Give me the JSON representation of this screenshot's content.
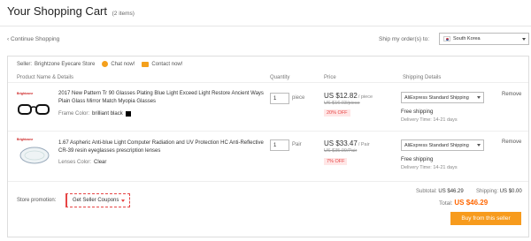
{
  "header": {
    "title": "Your Shopping Cart",
    "item_count": "(2 items)"
  },
  "nav": {
    "continue_label": "Continue Shopping",
    "ship_label": "Ship my order(s) to:",
    "ship_country": "South Korea"
  },
  "seller": {
    "label": "Seller:",
    "name": "Brightzone Eyecare Store",
    "chat_label": "Chat now!",
    "contact_label": "Contact now!"
  },
  "columns": {
    "product": "Product Name & Details",
    "quantity": "Quantity",
    "price": "Price",
    "shipping": "Shipping Details"
  },
  "items": [
    {
      "brand": "Brightzone",
      "name": "2017 New Pattern Tr 90 Glasses Plating Blue Light Exceed Light Restore Ancient Ways Plain Glass Mirror Match Myopia Glasses",
      "attr_label": "Frame Color:",
      "attr_value": "brilliant black",
      "quantity": "1",
      "unit": "piece",
      "price": "US $12.82",
      "price_per": "/ piece",
      "old_price": "US $16.03/piece",
      "discount": "20% OFF",
      "shipping_method": "AliExpress Standard Shipping",
      "shipping_fee": "Free shipping",
      "delivery": "Delivery Time: 14-21 days",
      "remove": "Remove"
    },
    {
      "brand": "Brightzone",
      "name": "1.67 Aspheric Anti-blue Light Computer Radiation and UV Protection HC Anti-Reflective CR-39 resin eyeglasses prescription lenses",
      "attr_label": "Lenses Color:",
      "attr_value": "Clear",
      "quantity": "1",
      "unit": "Pair",
      "price": "US $33.47",
      "price_per": "/ Pair",
      "old_price": "US $35.99/Pair",
      "discount": "7% OFF",
      "shipping_method": "AliExpress Standard Shipping",
      "shipping_fee": "Free shipping",
      "delivery": "Delivery Time: 14-21 days",
      "remove": "Remove"
    }
  ],
  "footer": {
    "promo_label": "Store promotion:",
    "coupon_label": "Get Seller Coupons",
    "subtotal_label": "Subtotal:",
    "subtotal_value": "US $46.29",
    "shipping_label": "Shipping:",
    "shipping_value": "US $0.00",
    "total_label": "Total:",
    "total_value": "US $46.29",
    "buy_label": "Buy from this seller"
  },
  "colors": {
    "accent": "#f79b1d",
    "total": "#ff6600",
    "discount": "#e64545"
  }
}
